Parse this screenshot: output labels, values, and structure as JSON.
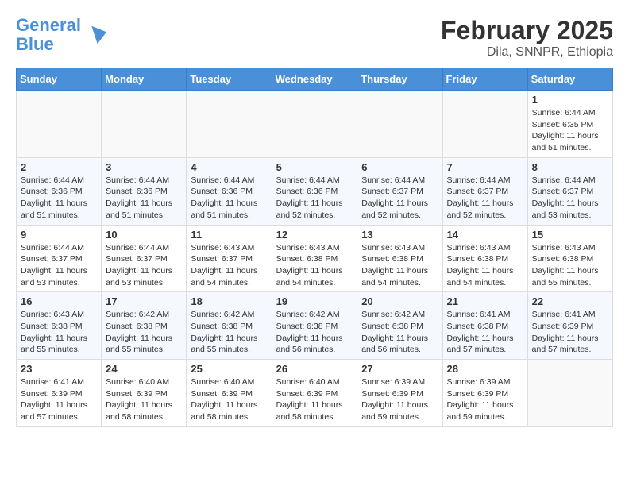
{
  "header": {
    "logo_line1": "General",
    "logo_line2": "Blue",
    "month_title": "February 2025",
    "subtitle": "Dila, SNNPR, Ethiopia"
  },
  "days_of_week": [
    "Sunday",
    "Monday",
    "Tuesday",
    "Wednesday",
    "Thursday",
    "Friday",
    "Saturday"
  ],
  "weeks": [
    [
      {
        "day": "",
        "info": ""
      },
      {
        "day": "",
        "info": ""
      },
      {
        "day": "",
        "info": ""
      },
      {
        "day": "",
        "info": ""
      },
      {
        "day": "",
        "info": ""
      },
      {
        "day": "",
        "info": ""
      },
      {
        "day": "1",
        "info": "Sunrise: 6:44 AM\nSunset: 6:35 PM\nDaylight: 11 hours and 51 minutes."
      }
    ],
    [
      {
        "day": "2",
        "info": "Sunrise: 6:44 AM\nSunset: 6:36 PM\nDaylight: 11 hours and 51 minutes."
      },
      {
        "day": "3",
        "info": "Sunrise: 6:44 AM\nSunset: 6:36 PM\nDaylight: 11 hours and 51 minutes."
      },
      {
        "day": "4",
        "info": "Sunrise: 6:44 AM\nSunset: 6:36 PM\nDaylight: 11 hours and 51 minutes."
      },
      {
        "day": "5",
        "info": "Sunrise: 6:44 AM\nSunset: 6:36 PM\nDaylight: 11 hours and 52 minutes."
      },
      {
        "day": "6",
        "info": "Sunrise: 6:44 AM\nSunset: 6:37 PM\nDaylight: 11 hours and 52 minutes."
      },
      {
        "day": "7",
        "info": "Sunrise: 6:44 AM\nSunset: 6:37 PM\nDaylight: 11 hours and 52 minutes."
      },
      {
        "day": "8",
        "info": "Sunrise: 6:44 AM\nSunset: 6:37 PM\nDaylight: 11 hours and 53 minutes."
      }
    ],
    [
      {
        "day": "9",
        "info": "Sunrise: 6:44 AM\nSunset: 6:37 PM\nDaylight: 11 hours and 53 minutes."
      },
      {
        "day": "10",
        "info": "Sunrise: 6:44 AM\nSunset: 6:37 PM\nDaylight: 11 hours and 53 minutes."
      },
      {
        "day": "11",
        "info": "Sunrise: 6:43 AM\nSunset: 6:37 PM\nDaylight: 11 hours and 54 minutes."
      },
      {
        "day": "12",
        "info": "Sunrise: 6:43 AM\nSunset: 6:38 PM\nDaylight: 11 hours and 54 minutes."
      },
      {
        "day": "13",
        "info": "Sunrise: 6:43 AM\nSunset: 6:38 PM\nDaylight: 11 hours and 54 minutes."
      },
      {
        "day": "14",
        "info": "Sunrise: 6:43 AM\nSunset: 6:38 PM\nDaylight: 11 hours and 54 minutes."
      },
      {
        "day": "15",
        "info": "Sunrise: 6:43 AM\nSunset: 6:38 PM\nDaylight: 11 hours and 55 minutes."
      }
    ],
    [
      {
        "day": "16",
        "info": "Sunrise: 6:43 AM\nSunset: 6:38 PM\nDaylight: 11 hours and 55 minutes."
      },
      {
        "day": "17",
        "info": "Sunrise: 6:42 AM\nSunset: 6:38 PM\nDaylight: 11 hours and 55 minutes."
      },
      {
        "day": "18",
        "info": "Sunrise: 6:42 AM\nSunset: 6:38 PM\nDaylight: 11 hours and 55 minutes."
      },
      {
        "day": "19",
        "info": "Sunrise: 6:42 AM\nSunset: 6:38 PM\nDaylight: 11 hours and 56 minutes."
      },
      {
        "day": "20",
        "info": "Sunrise: 6:42 AM\nSunset: 6:38 PM\nDaylight: 11 hours and 56 minutes."
      },
      {
        "day": "21",
        "info": "Sunrise: 6:41 AM\nSunset: 6:38 PM\nDaylight: 11 hours and 57 minutes."
      },
      {
        "day": "22",
        "info": "Sunrise: 6:41 AM\nSunset: 6:39 PM\nDaylight: 11 hours and 57 minutes."
      }
    ],
    [
      {
        "day": "23",
        "info": "Sunrise: 6:41 AM\nSunset: 6:39 PM\nDaylight: 11 hours and 57 minutes."
      },
      {
        "day": "24",
        "info": "Sunrise: 6:40 AM\nSunset: 6:39 PM\nDaylight: 11 hours and 58 minutes."
      },
      {
        "day": "25",
        "info": "Sunrise: 6:40 AM\nSunset: 6:39 PM\nDaylight: 11 hours and 58 minutes."
      },
      {
        "day": "26",
        "info": "Sunrise: 6:40 AM\nSunset: 6:39 PM\nDaylight: 11 hours and 58 minutes."
      },
      {
        "day": "27",
        "info": "Sunrise: 6:39 AM\nSunset: 6:39 PM\nDaylight: 11 hours and 59 minutes."
      },
      {
        "day": "28",
        "info": "Sunrise: 6:39 AM\nSunset: 6:39 PM\nDaylight: 11 hours and 59 minutes."
      },
      {
        "day": "",
        "info": ""
      }
    ]
  ]
}
